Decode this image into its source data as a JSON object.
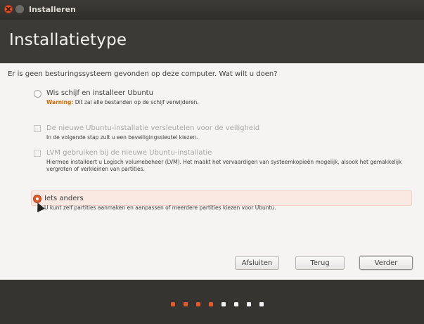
{
  "window": {
    "title": "Installeren"
  },
  "header": {
    "title": "Installatietype"
  },
  "question": "Er is geen besturingssysteem gevonden op deze computer. Wat wilt u doen?",
  "options": [
    {
      "label": "Wis schijf en installeer Ubuntu",
      "warning_label": "Warning:",
      "sub": "Dit zal alle bestanden op de schijf verwijderen.",
      "kind": "radio",
      "enabled": true,
      "selected": false
    },
    {
      "label": "De nieuwe Ubuntu-installatie versleutelen voor de veiligheid",
      "sub": "In de volgende stap zult u een beveiligingssleutel kiezen.",
      "kind": "checkbox",
      "enabled": false,
      "checked": false
    },
    {
      "label": "LVM gebruiken bij de nieuwe Ubuntu-installatie",
      "sub": "Hiermee installeert u Logisch volumebeheer (LVM). Het maakt het vervaardigen van systeemkopieën mogelijk, alsook het gemakkelijk vergroten of verkleinen van partities.",
      "kind": "checkbox",
      "enabled": false,
      "checked": false
    },
    {
      "label": "Iets anders",
      "sub": "U kunt zelf partities aanmaken en aanpassen of meerdere partities kiezen voor Ubuntu.",
      "kind": "radio",
      "enabled": true,
      "selected": true
    }
  ],
  "buttons": {
    "quit": "Afsluiten",
    "back": "Terug",
    "next": "Verder"
  },
  "progress": {
    "total_steps": 8,
    "completed_steps": 4
  },
  "colors": {
    "accent": "#e15a2c",
    "header_bg": "#3b3a36",
    "footer_bg": "#353431",
    "warning": "#d36b00"
  }
}
